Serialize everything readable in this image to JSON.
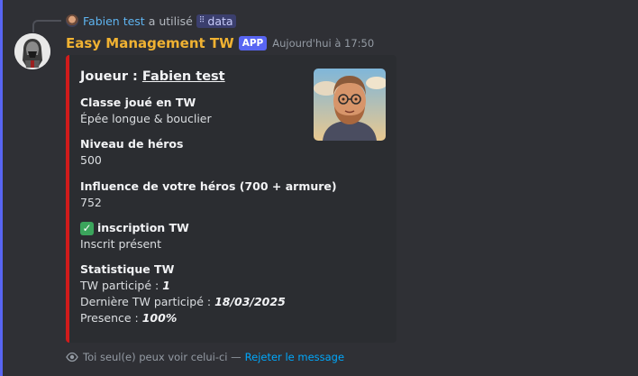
{
  "reply": {
    "user": "Fabien test",
    "action": "a utilisé",
    "command": "data"
  },
  "message": {
    "author": "Easy Management TW",
    "badge": "APP",
    "timestamp": "Aujourd'hui à 17:50"
  },
  "embed": {
    "title_prefix": "Joueur : ",
    "title_player": "Fabien test",
    "border_color": "#d11b1b",
    "fields": [
      {
        "name": "Classe joué en TW",
        "value": "Épée longue & bouclier"
      },
      {
        "name": "Niveau de héros",
        "value": "500"
      },
      {
        "name": "Influence de votre héros (700 + armure)",
        "value": "752"
      },
      {
        "name": "inscription TW",
        "value": "Inscrit présent",
        "icon": "check-box-icon"
      },
      {
        "name": "Statistique TW"
      }
    ],
    "stats": [
      {
        "label": "TW participé : ",
        "value": "1"
      },
      {
        "label": "Dernière TW participé : ",
        "value": "18/03/2025"
      },
      {
        "label": "Presence : ",
        "value": "100%"
      }
    ]
  },
  "footer": {
    "text": "Toi seul(e) peux voir celui-ci —",
    "dismiss": "Rejeter le message"
  }
}
